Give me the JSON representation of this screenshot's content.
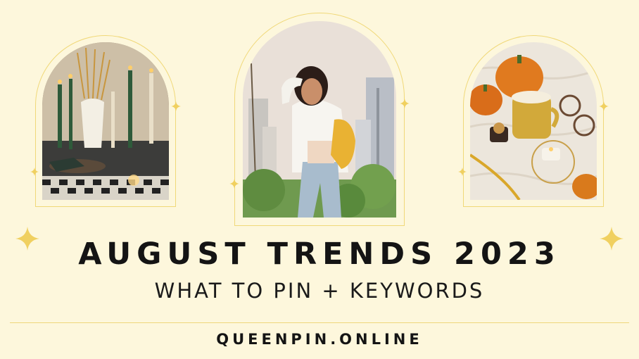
{
  "heading": {
    "title": "AUGUST TRENDS 2023",
    "subtitle": "WHAT TO PIN + KEYWORDS"
  },
  "footer": {
    "website": "QUEENPIN.ONLINE"
  },
  "photos": [
    {
      "subject": "autumn table setting with candles"
    },
    {
      "subject": "woman with yellow backpack in city"
    },
    {
      "subject": "cozy flatlay with pumpkins and latte"
    }
  ],
  "colors": {
    "background": "#fdf7dc",
    "accent_gold": "#f0d878",
    "text": "#141414"
  },
  "icons": [
    "sparkle-icon"
  ]
}
